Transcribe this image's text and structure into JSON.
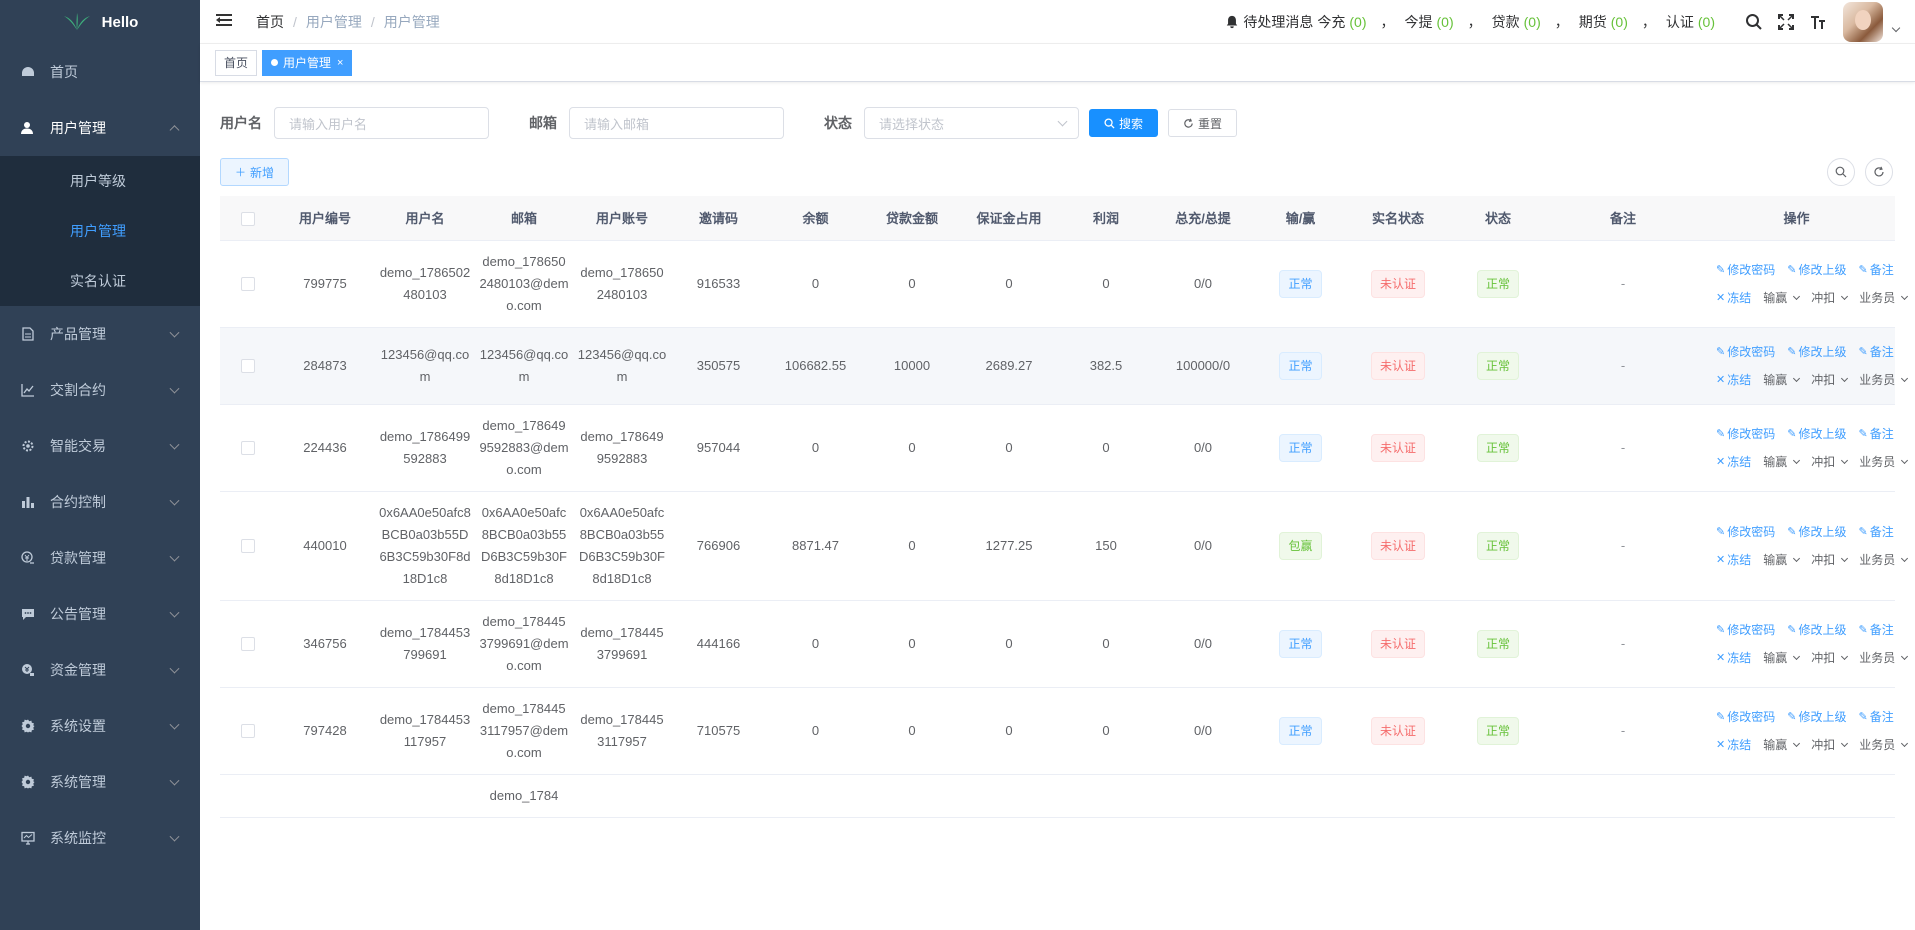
{
  "logo": {
    "text": "Hello"
  },
  "sidebar": {
    "items": [
      {
        "label": "首页",
        "icon": "dashboard-icon"
      },
      {
        "label": "用户管理",
        "icon": "user-icon",
        "open": true,
        "children": [
          {
            "label": "用户等级"
          },
          {
            "label": "用户管理",
            "active": true
          },
          {
            "label": "实名认证"
          }
        ]
      },
      {
        "label": "产品管理",
        "icon": "document-icon"
      },
      {
        "label": "交割合约",
        "icon": "chart-line-icon"
      },
      {
        "label": "智能交易",
        "icon": "cog-icon"
      },
      {
        "label": "合约控制",
        "icon": "bar-chart-icon"
      },
      {
        "label": "贷款管理",
        "icon": "money-icon"
      },
      {
        "label": "公告管理",
        "icon": "message-icon"
      },
      {
        "label": "资金管理",
        "icon": "fund-icon"
      },
      {
        "label": "系统设置",
        "icon": "gear-icon"
      },
      {
        "label": "系统管理",
        "icon": "gear-icon"
      },
      {
        "label": "系统监控",
        "icon": "monitor-icon"
      }
    ]
  },
  "header": {
    "breadcrumb": [
      "首页",
      "用户管理",
      "用户管理"
    ],
    "notice_label": "待处理消息",
    "stats": [
      {
        "label": "今充",
        "count": "(0)"
      },
      {
        "label": "今提",
        "count": "(0)"
      },
      {
        "label": "贷款",
        "count": "(0)"
      },
      {
        "label": "期货",
        "count": "(0)"
      },
      {
        "label": "认证",
        "count": "(0)"
      }
    ]
  },
  "tags": [
    {
      "label": "首页"
    },
    {
      "label": "用户管理",
      "active": true
    }
  ],
  "search": {
    "username_label": "用户名",
    "username_placeholder": "请输入用户名",
    "email_label": "邮箱",
    "email_placeholder": "请输入邮箱",
    "status_label": "状态",
    "status_placeholder": "请选择状态",
    "search_btn": "搜索",
    "reset_btn": "重置"
  },
  "toolbar": {
    "add_btn": "新增"
  },
  "table": {
    "columns": [
      "用户编号",
      "用户名",
      "邮箱",
      "用户账号",
      "邀请码",
      "余额",
      "贷款金额",
      "保证金占用",
      "利润",
      "总充/总提",
      "输/赢",
      "实名状态",
      "状态",
      "备注",
      "操作"
    ],
    "actions": {
      "change_password": "修改密码",
      "change_parent": "修改上级",
      "remark": "备注",
      "freeze": "冻结",
      "win_lose": "输赢",
      "adjust": "冲扣",
      "salesman": "业务员"
    },
    "rows": [
      {
        "id": "799775",
        "username": "demo_1786502480103",
        "email": "demo_1786502480103@demo.com",
        "account": "demo_1786502480103",
        "invite": "916533",
        "balance": "0",
        "loan": "0",
        "margin": "0",
        "profit": "0",
        "total": "0/0",
        "winlose": "正常",
        "realname": "未认证",
        "status": "正常",
        "remark": "-"
      },
      {
        "id": "284873",
        "username": "123456@qq.com",
        "email": "123456@qq.com",
        "account": "123456@qq.com",
        "invite": "350575",
        "balance": "106682.55",
        "loan": "10000",
        "margin": "2689.27",
        "profit": "382.5",
        "total": "100000/0",
        "winlose": "正常",
        "realname": "未认证",
        "status": "正常",
        "remark": "-"
      },
      {
        "id": "224436",
        "username": "demo_1786499592883",
        "email": "demo_1786499592883@demo.com",
        "account": "demo_1786499592883",
        "invite": "957044",
        "balance": "0",
        "loan": "0",
        "margin": "0",
        "profit": "0",
        "total": "0/0",
        "winlose": "正常",
        "realname": "未认证",
        "status": "正常",
        "remark": "-"
      },
      {
        "id": "440010",
        "username": "0x6AA0e50afc8BCB0a03b55D6B3C59b30F8d18D1c8",
        "email": "0x6AA0e50afc8BCB0a03b55D6B3C59b30F8d18D1c8",
        "account": "0x6AA0e50afc8BCB0a03b55D6B3C59b30F8d18D1c8",
        "invite": "766906",
        "balance": "8871.47",
        "loan": "0",
        "margin": "1277.25",
        "profit": "150",
        "total": "0/0",
        "winlose": "包赢",
        "realname": "未认证",
        "status": "正常",
        "remark": "-"
      },
      {
        "id": "346756",
        "username": "demo_1784453799691",
        "email": "demo_1784453799691@demo.com",
        "account": "demo_1784453799691",
        "invite": "444166",
        "balance": "0",
        "loan": "0",
        "margin": "0",
        "profit": "0",
        "total": "0/0",
        "winlose": "正常",
        "realname": "未认证",
        "status": "正常",
        "remark": "-"
      },
      {
        "id": "797428",
        "username": "demo_1784453117957",
        "email": "demo_1784453117957@demo.com",
        "account": "demo_1784453117957",
        "invite": "710575",
        "balance": "0",
        "loan": "0",
        "margin": "0",
        "profit": "0",
        "total": "0/0",
        "winlose": "正常",
        "realname": "未认证",
        "status": "正常",
        "remark": "-"
      },
      {
        "id": "",
        "username": "",
        "email": "demo_1784",
        "account": "",
        "invite": "",
        "balance": "",
        "loan": "",
        "margin": "",
        "profit": "",
        "total": "",
        "winlose": "",
        "realname": "",
        "status": "",
        "remark": ""
      }
    ]
  },
  "colors": {
    "sidebar_bg": "#304156",
    "submenu_bg": "#1f2d3d",
    "primary": "#409eff",
    "success": "#67c23a",
    "danger": "#f56c6c"
  }
}
